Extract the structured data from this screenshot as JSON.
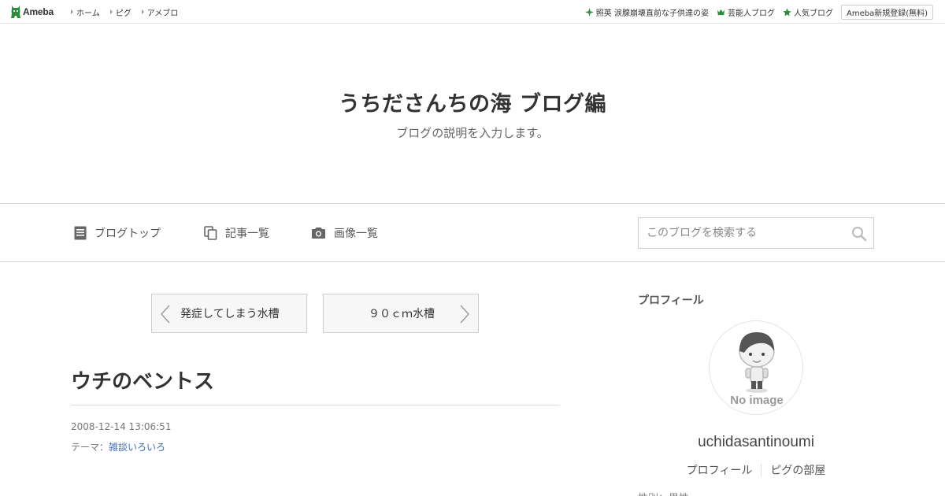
{
  "topbar": {
    "logo_text": "Ameba",
    "nav": [
      {
        "label": "ホーム"
      },
      {
        "label": "ピグ"
      },
      {
        "label": "アメブロ"
      }
    ],
    "right_links": [
      {
        "label": "照英 涙腺崩壊直前な子供達の姿",
        "icon": "sparkle-icon"
      },
      {
        "label": "芸能人ブログ",
        "icon": "crown-icon"
      },
      {
        "label": "人気ブログ",
        "icon": "star-icon"
      }
    ],
    "register_label": "Ameba新規登録(無料)",
    "accent": "#2d8c3c"
  },
  "header": {
    "title": "うちださんちの海 ブログ編",
    "description": "ブログの説明を入力します。"
  },
  "nav": {
    "items": [
      {
        "label": "ブログトップ",
        "icon": "document-icon"
      },
      {
        "label": "記事一覧",
        "icon": "copy-icon"
      },
      {
        "label": "画像一覧",
        "icon": "camera-icon"
      }
    ],
    "search_placeholder": "このブログを検索する"
  },
  "pager": {
    "prev_label": "発症してしまう水槽",
    "next_label": "９０ｃｍ水槽"
  },
  "article": {
    "title": "ウチのベントス",
    "date": "2008-12-14 13:06:51",
    "theme_prefix": "テーマ：",
    "theme_label": "雑談いろいろ"
  },
  "sidebar": {
    "heading": "プロフィール",
    "avatar_text": "No image",
    "username": "uchidasantinoumi",
    "links": [
      {
        "label": "プロフィール"
      },
      {
        "label": "ピグの部屋"
      }
    ],
    "cut_text": "性別：男性"
  }
}
